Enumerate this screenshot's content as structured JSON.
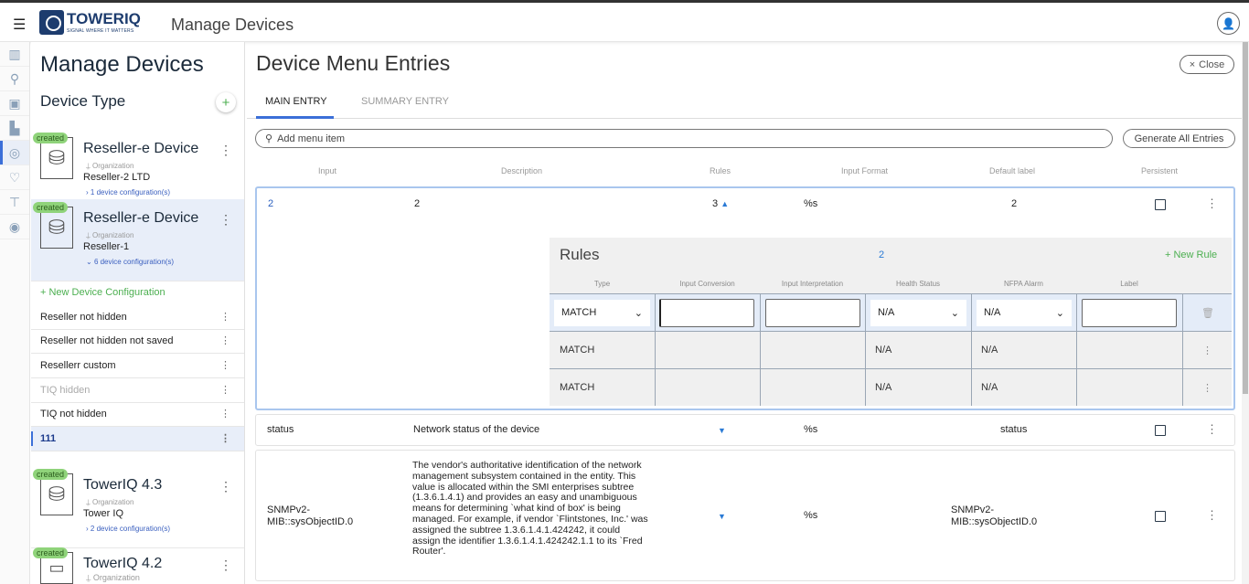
{
  "header": {
    "logo_text": "TOWERIQ",
    "logo_tagline": "SIGNAL WHERE IT MATTERS",
    "title": "Manage Devices"
  },
  "sidebar": {
    "title": "Manage Devices",
    "subtitle": "Device Type",
    "add_label": "+",
    "devices": [
      {
        "badge": "created",
        "name": "Reseller-e Device",
        "org_label": "Organization",
        "org": "Reseller-2 LTD",
        "configs": "1 device configuration(s)",
        "chevron": "›"
      },
      {
        "badge": "created",
        "name": "Reseller-e Device",
        "org_label": "Organization",
        "org": "Reseller-1",
        "configs": "6 device configuration(s)",
        "chevron": "⌄"
      },
      {
        "badge": "created",
        "name": "TowerIQ 4.3",
        "org_label": "Organization",
        "org": "Tower IQ",
        "configs": "2 device configuration(s)",
        "chevron": "›"
      },
      {
        "badge": "created",
        "name": "TowerIQ 4.2",
        "org_label": "Organization",
        "org": "",
        "configs": "",
        "chevron": ""
      }
    ],
    "new_config": "+ New Device Configuration",
    "configs": [
      "Reseller not hidden",
      "Reseller not hidden not saved",
      "Resellerr custom",
      "TIQ hidden",
      "TIQ not hidden",
      "111"
    ]
  },
  "main": {
    "title": "Device Menu Entries",
    "close": "Close",
    "tabs": [
      "MAIN ENTRY",
      "SUMMARY ENTRY"
    ],
    "search_placeholder": "Add menu item",
    "generate": "Generate All Entries",
    "columns": [
      "Input",
      "Description",
      "Rules",
      "Input Format",
      "Default label",
      "Persistent"
    ],
    "entries": [
      {
        "input": "2",
        "description": "2",
        "rules": "3",
        "format": "%s",
        "default_label": "2"
      },
      {
        "input": "status",
        "description": "Network status of the device",
        "rules": "",
        "format": "%s",
        "default_label": "status"
      },
      {
        "input": "SNMPv2-MIB::sysObjectID.0",
        "description": "The vendor's authoritative identification of the network management subsystem contained in the entity. This value is allocated within the SMI enterprises subtree (1.3.6.1.4.1) and provides an easy and unambiguous means for determining `what kind of box' is being managed. For example, if vendor `Flintstones, Inc.' was assigned the subtree 1.3.6.1.4.1.424242, it could assign the identifier 1.3.6.1.4.1.424242.1.1 to its `Fred Router'.",
        "rules": "",
        "format": "%s",
        "default_label": "SNMPv2-MIB::sysObjectID.0"
      }
    ],
    "rules": {
      "title": "Rules",
      "count": "2",
      "new_rule": "+ New Rule",
      "columns": [
        "Type",
        "Input Conversion",
        "Input Interpretation",
        "Health Status",
        "NFPA Alarm",
        "Label"
      ],
      "edit_row": {
        "type": "MATCH",
        "health": "N/A",
        "nfpa": "N/A"
      },
      "rows": [
        {
          "type": "MATCH",
          "health": "N/A",
          "nfpa": "N/A"
        },
        {
          "type": "MATCH",
          "health": "N/A",
          "nfpa": "N/A"
        }
      ]
    }
  }
}
